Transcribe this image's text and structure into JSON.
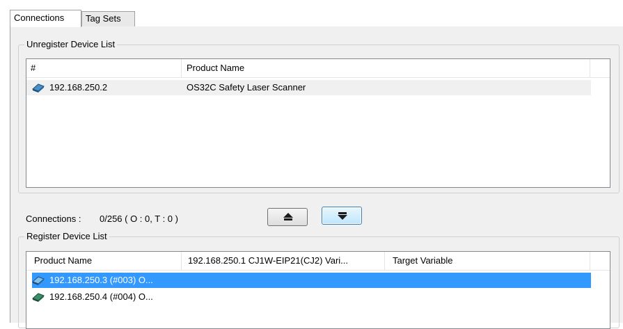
{
  "tabs": [
    {
      "label": "Connections",
      "active": true
    },
    {
      "label": "Tag Sets",
      "active": false
    }
  ],
  "unregister": {
    "title": "Unregister Device List",
    "columns": [
      "#",
      "Product Name"
    ],
    "rows": [
      {
        "address": "192.168.250.2",
        "product": "OS32C Safety Laser Scanner",
        "icon": "network-device-icon"
      }
    ]
  },
  "connections": {
    "label": "Connections :",
    "value": "0/256 ( O : 0, T : 0 )"
  },
  "buttons": {
    "register": {
      "icon": "arrow-down-icon"
    },
    "unregister": {
      "icon": "arrow-up-icon"
    }
  },
  "register": {
    "title": "Register Device List",
    "columns": [
      "Product Name",
      "192.168.250.1 CJ1W-EIP21(CJ2) Vari...",
      "Target Variable"
    ],
    "rows": [
      {
        "name": "192.168.250.3 (#003) O...",
        "selected": true,
        "icon": "network-device-icon"
      },
      {
        "name": "192.168.250.4 (#004) O...",
        "selected": false,
        "icon": "network-device-icon"
      }
    ]
  },
  "colors": {
    "selection": "#3399ff",
    "panel": "#f0f0f0",
    "border": "#828790"
  }
}
